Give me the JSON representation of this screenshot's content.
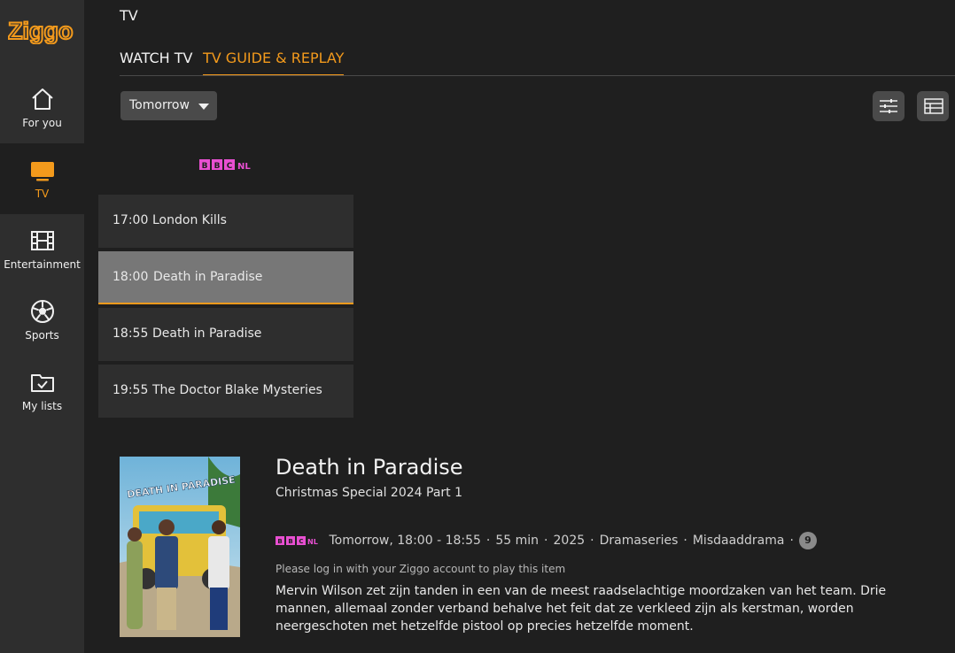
{
  "brand": {
    "logo_text": "Ziggo",
    "accent": "#f39a1c"
  },
  "sidebar": {
    "items": [
      {
        "label": "For you",
        "icon": "home-icon"
      },
      {
        "label": "TV",
        "icon": "tv-icon",
        "active": true
      },
      {
        "label": "Entertainment",
        "icon": "film-icon"
      },
      {
        "label": "Sports",
        "icon": "football-icon"
      },
      {
        "label": "My lists",
        "icon": "folder-check-icon"
      }
    ]
  },
  "header": {
    "title": "TV",
    "tabs": [
      {
        "label": "WATCH TV",
        "active": false
      },
      {
        "label": "TV GUIDE & REPLAY",
        "active": true
      }
    ]
  },
  "controls": {
    "day_select": "Tomorrow",
    "filter_icon": "sliders-icon",
    "grid_icon": "grid-view-icon"
  },
  "channel": {
    "name": "BBC NL",
    "logo_letters": [
      "B",
      "B",
      "C"
    ],
    "logo_suffix": "NL",
    "logo_color": "#e84fd1"
  },
  "programs": [
    {
      "time": "17:00",
      "title": "London Kills"
    },
    {
      "time": "18:00",
      "title": "Death in Paradise",
      "selected": true
    },
    {
      "time": "18:55",
      "title": "Death in Paradise"
    },
    {
      "time": "19:55",
      "title": "The Doctor Blake Mysteries"
    }
  ],
  "detail": {
    "poster_text": "DEATH IN PARADISE",
    "title": "Death in Paradise",
    "subtitle": "Christmas Special 2024 Part 1",
    "meta": {
      "airing": "Tomorrow, 18:00 - 18:55",
      "duration": "55 min",
      "year": "2025",
      "genre1": "Dramaseries",
      "genre2": "Misdaaddrama",
      "age_rating": "9"
    },
    "login_note": "Please log in with your Ziggo account to play this item",
    "description": "Mervin Wilson zet zijn tanden in een van de meest raadselachtige moordzaken van het team. Drie mannen, allemaal zonder verband behalve het feit dat ze verkleed zijn als kerstman, worden neergeschoten met hetzelfde pistool op precies hetzelfde moment."
  }
}
